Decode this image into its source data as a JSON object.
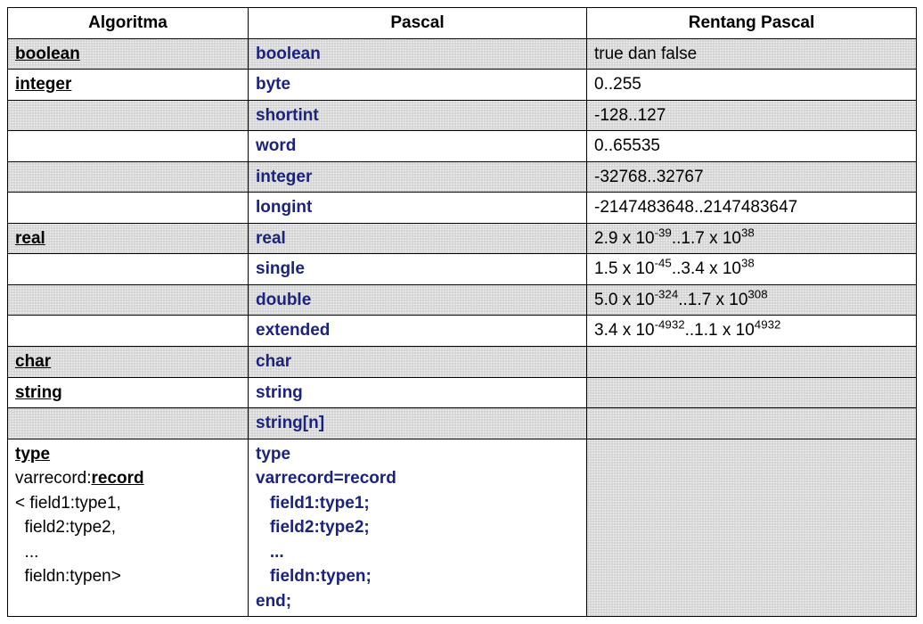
{
  "headers": {
    "c1": "Algoritma",
    "c2": "Pascal",
    "c3": "Rentang Pascal"
  },
  "rows": [
    {
      "shade": true,
      "alg": "boolean",
      "pas": "boolean",
      "rng": "true dan false"
    },
    {
      "shade": false,
      "alg": "integer",
      "pas": "byte",
      "rng": "0..255"
    },
    {
      "shade": true,
      "alg": "",
      "pas": "shortint",
      "rng": "-128..127"
    },
    {
      "shade": false,
      "alg": "",
      "pas": "word",
      "rng": "0..65535"
    },
    {
      "shade": true,
      "alg": "",
      "pas": "integer",
      "rng": "-32768..32767"
    },
    {
      "shade": false,
      "alg": "",
      "pas": "longint",
      "rng": "-2147483648..2147483647"
    },
    {
      "shade": true,
      "alg": "real",
      "pas": "real",
      "rng_html": "2.9 x 10<sup>-39</sup>..1.7 x 10<sup>38</sup>"
    },
    {
      "shade": false,
      "alg": "",
      "pas": "single",
      "rng_html": "1.5 x 10<sup>-45</sup>..3.4 x 10<sup>38</sup>"
    },
    {
      "shade": true,
      "alg": "",
      "pas": "double",
      "rng_html": "5.0 x 10<sup>-324</sup>..1.7 x 10<sup>308</sup>"
    },
    {
      "shade": false,
      "alg": "",
      "pas": "extended",
      "rng_html": "3.4 x 10<sup>-4932</sup>..1.1 x 10<sup>4932</sup>"
    },
    {
      "shade": true,
      "alg": "char",
      "pas": "char",
      "rng": "",
      "rng_shade": true
    },
    {
      "shade": false,
      "alg": "string",
      "pas": "string",
      "rng": "",
      "rng_shade": true
    },
    {
      "shade": true,
      "alg": "",
      "pas": "string[n]",
      "rng": "",
      "rng_shade": true
    },
    {
      "shade": false,
      "alg_lines": [
        {
          "text": "type",
          "style": "alg"
        },
        {
          "pre": "varrecord:",
          "ul": "record"
        },
        {
          "text": "< field1:type1,"
        },
        {
          "text": "  field2:type2,"
        },
        {
          "text": "  ..."
        },
        {
          "text": "  fieldn:typen>"
        }
      ],
      "pas_lines": [
        "type",
        "varrecord=record",
        "   field1:type1;",
        "   field2:type2;",
        "   ...",
        "   fieldn:typen;",
        "end;"
      ],
      "rng": "",
      "rng_shade": true
    }
  ]
}
